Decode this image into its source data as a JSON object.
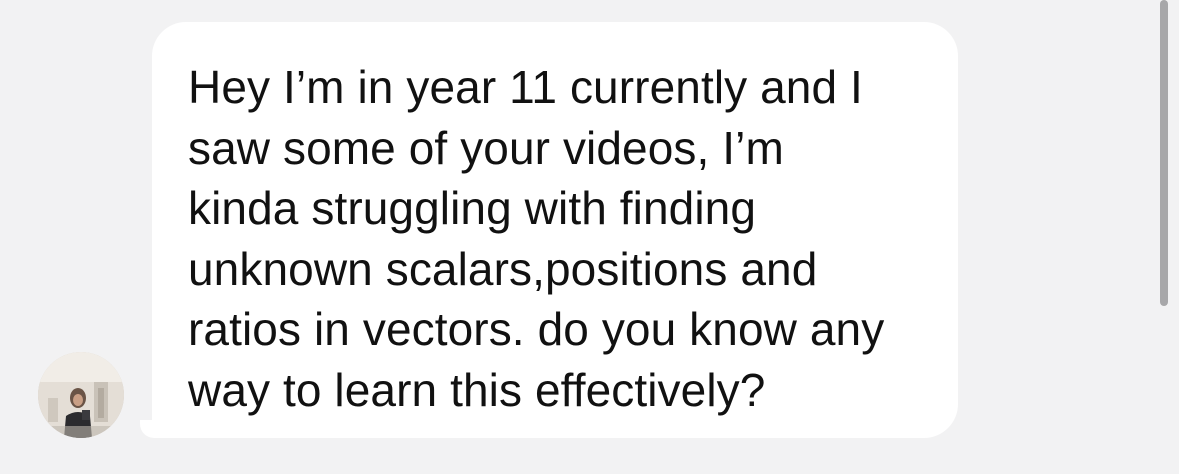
{
  "message": {
    "text": "Hey I’m in year 11 currently and I\nsaw some of your videos, I’m\nkinda struggling with finding\nunknown scalars,positions and\nratios in vectors. do you know any\nway to learn this effectively?"
  },
  "icons": {
    "avatar": "profile-photo"
  },
  "colors": {
    "background": "#f2f2f3",
    "bubble": "#ffffff",
    "text": "#111111",
    "scrollbar": "#a7a7a9"
  }
}
